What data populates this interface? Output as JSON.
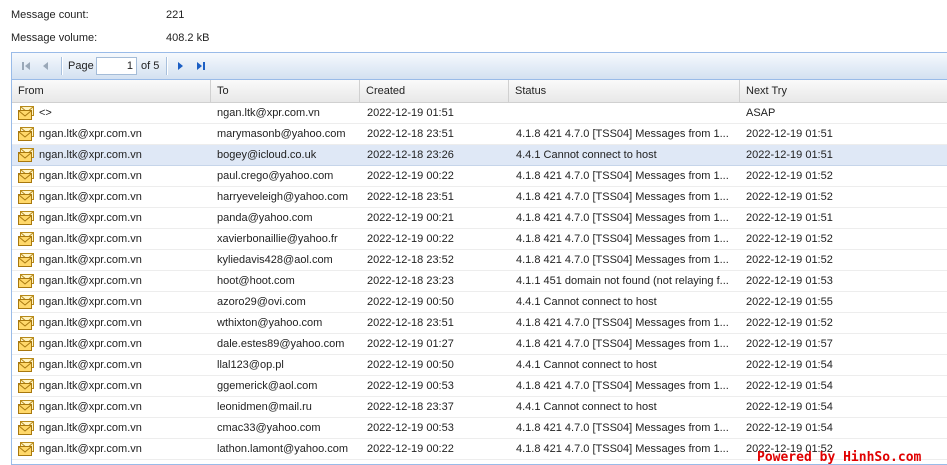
{
  "stats": {
    "count_label": "Message count:",
    "count_value": "221",
    "volume_label": "Message volume:",
    "volume_value": "408.2 kB"
  },
  "pager": {
    "page_label": "Page",
    "page_value": "1",
    "of_label": "of 5",
    "icons": [
      "first-page-icon",
      "prev-page-icon",
      "next-page-icon",
      "last-page-icon"
    ]
  },
  "columns": [
    "From",
    "To",
    "Created",
    "Status",
    "Next Try"
  ],
  "rows": [
    {
      "from": "<>",
      "to": "ngan.ltk@xpr.com.vn",
      "created": "2022-12-19 01:51",
      "status": "",
      "next_try": "ASAP"
    },
    {
      "from": "ngan.ltk@xpr.com.vn",
      "to": "marymasonb@yahoo.com",
      "created": "2022-12-18 23:51",
      "status": "4.1.8 421 4.7.0 [TSS04] Messages from 1...",
      "next_try": "2022-12-19 01:51"
    },
    {
      "from": "ngan.ltk@xpr.com.vn",
      "to": "bogey@icloud.co.uk",
      "created": "2022-12-18 23:26",
      "status": "4.4.1 Cannot connect to host",
      "next_try": "2022-12-19 01:51"
    },
    {
      "from": "ngan.ltk@xpr.com.vn",
      "to": "paul.crego@yahoo.com",
      "created": "2022-12-19 00:22",
      "status": "4.1.8 421 4.7.0 [TSS04] Messages from 1...",
      "next_try": "2022-12-19 01:52"
    },
    {
      "from": "ngan.ltk@xpr.com.vn",
      "to": "harryeveleigh@yahoo.com",
      "created": "2022-12-18 23:51",
      "status": "4.1.8 421 4.7.0 [TSS04] Messages from 1...",
      "next_try": "2022-12-19 01:52"
    },
    {
      "from": "ngan.ltk@xpr.com.vn",
      "to": "panda@yahoo.com",
      "created": "2022-12-19 00:21",
      "status": "4.1.8 421 4.7.0 [TSS04] Messages from 1...",
      "next_try": "2022-12-19 01:51"
    },
    {
      "from": "ngan.ltk@xpr.com.vn",
      "to": "xavierbonaillie@yahoo.fr",
      "created": "2022-12-19 00:22",
      "status": "4.1.8 421 4.7.0 [TSS04] Messages from 1...",
      "next_try": "2022-12-19 01:52"
    },
    {
      "from": "ngan.ltk@xpr.com.vn",
      "to": "kyliedavis428@aol.com",
      "created": "2022-12-18 23:52",
      "status": "4.1.8 421 4.7.0 [TSS04] Messages from 1...",
      "next_try": "2022-12-19 01:52"
    },
    {
      "from": "ngan.ltk@xpr.com.vn",
      "to": "hoot@hoot.com",
      "created": "2022-12-18 23:23",
      "status": "4.1.1 451 domain not found (not relaying f...",
      "next_try": "2022-12-19 01:53"
    },
    {
      "from": "ngan.ltk@xpr.com.vn",
      "to": "azoro29@ovi.com",
      "created": "2022-12-19 00:50",
      "status": "4.4.1 Cannot connect to host",
      "next_try": "2022-12-19 01:55"
    },
    {
      "from": "ngan.ltk@xpr.com.vn",
      "to": "wthixton@yahoo.com",
      "created": "2022-12-18 23:51",
      "status": "4.1.8 421 4.7.0 [TSS04] Messages from 1...",
      "next_try": "2022-12-19 01:52"
    },
    {
      "from": "ngan.ltk@xpr.com.vn",
      "to": "dale.estes89@yahoo.com",
      "created": "2022-12-19 01:27",
      "status": "4.1.8 421 4.7.0 [TSS04] Messages from 1...",
      "next_try": "2022-12-19 01:57"
    },
    {
      "from": "ngan.ltk@xpr.com.vn",
      "to": "llal123@op.pl",
      "created": "2022-12-19 00:50",
      "status": "4.4.1 Cannot connect to host",
      "next_try": "2022-12-19 01:54"
    },
    {
      "from": "ngan.ltk@xpr.com.vn",
      "to": "ggemerick@aol.com",
      "created": "2022-12-19 00:53",
      "status": "4.1.8 421 4.7.0 [TSS04] Messages from 1...",
      "next_try": "2022-12-19 01:54"
    },
    {
      "from": "ngan.ltk@xpr.com.vn",
      "to": "leonidmen@mail.ru",
      "created": "2022-12-18 23:37",
      "status": "4.4.1 Cannot connect to host",
      "next_try": "2022-12-19 01:54"
    },
    {
      "from": "ngan.ltk@xpr.com.vn",
      "to": "cmac33@yahoo.com",
      "created": "2022-12-19 00:53",
      "status": "4.1.8 421 4.7.0 [TSS04] Messages from 1...",
      "next_try": "2022-12-19 01:54"
    },
    {
      "from": "ngan.ltk@xpr.com.vn",
      "to": "lathon.lamont@yahoo.com",
      "created": "2022-12-19 00:22",
      "status": "4.1.8 421 4.7.0 [TSS04] Messages from 1...",
      "next_try": "2022-12-19 01:52"
    }
  ],
  "selected_row": 2,
  "colors": {
    "grid_border": "#99bbe8",
    "selected_row": "#dfe8f6",
    "pager_arrow": "#1c5fc4",
    "watermark": "#e00000"
  },
  "watermark": "Powered by HinhSo.com"
}
